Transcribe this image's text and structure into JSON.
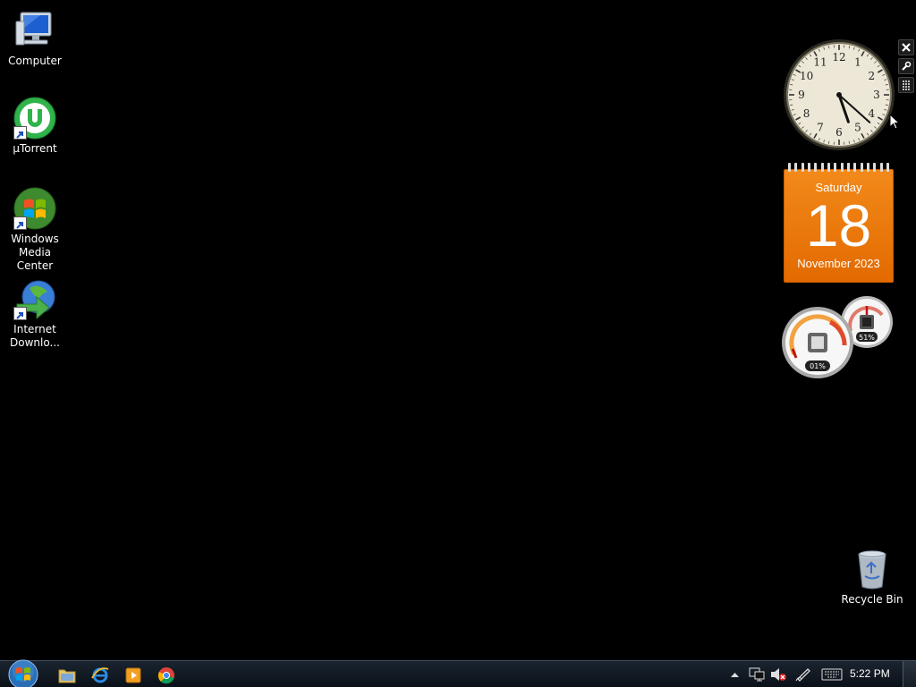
{
  "desktop": {
    "icons": [
      {
        "label": "Computer"
      },
      {
        "label": "µTorrent"
      },
      {
        "label": "Windows Media Center"
      },
      {
        "label": "Internet Downlo..."
      },
      {
        "label": "Recycle Bin"
      }
    ]
  },
  "gadgets": {
    "clock": {
      "time": "5:22",
      "numerals": [
        "12",
        "1",
        "2",
        "3",
        "4",
        "5",
        "6",
        "7",
        "8",
        "9",
        "10",
        "11"
      ]
    },
    "calendar": {
      "weekday": "Saturday",
      "day": "18",
      "month_year": "November 2023",
      "color": "#ee7a10"
    },
    "cpu_meter": {
      "cpu_percent": "01%",
      "memory_percent": "51%"
    },
    "controls": [
      "close-icon",
      "wrench-icon",
      "grip-icon"
    ]
  },
  "taskbar": {
    "pinned": [
      "file-explorer",
      "internet-explorer",
      "media-player",
      "chrome"
    ],
    "tray": {
      "clock": "5:22 PM"
    }
  }
}
